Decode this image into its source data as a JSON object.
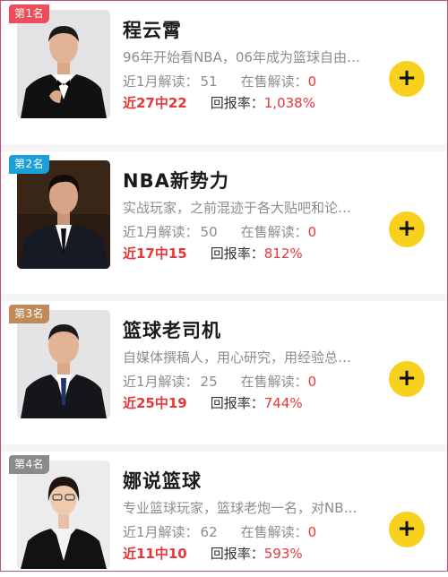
{
  "colors": {
    "rank1": "#ee4d5a",
    "rank2": "#1aa0d8",
    "rank3": "#c0895a",
    "rank4": "#8a8a8a",
    "accent_red": "#e8373a",
    "follow_yellow": "#f7d11e"
  },
  "experts": [
    {
      "rank": "第1名",
      "name": "程云霄",
      "bio": "96年开始看NBA，06年成为篮球自由…",
      "recent_label": "近1月解读：",
      "recent_count": "51",
      "on_sale_label": "在售解读：",
      "on_sale_count": "0",
      "streak": "近27中22",
      "return_label": "回报率：",
      "return_rate": "1,038%",
      "follow_icon": "+"
    },
    {
      "rank": "第2名",
      "name": "NBA新势力",
      "bio": "实战玩家，之前混迹于各大贴吧和论…",
      "recent_label": "近1月解读：",
      "recent_count": "50",
      "on_sale_label": "在售解读：",
      "on_sale_count": "0",
      "streak": "近17中15",
      "return_label": "回报率：",
      "return_rate": "812%",
      "follow_icon": "+"
    },
    {
      "rank": "第3名",
      "name": "篮球老司机",
      "bio": "自媒体撰稿人，用心研究，用经验总…",
      "recent_label": "近1月解读：",
      "recent_count": "25",
      "on_sale_label": "在售解读：",
      "on_sale_count": "0",
      "streak": "近25中19",
      "return_label": "回报率：",
      "return_rate": "744%",
      "follow_icon": "+"
    },
    {
      "rank": "第4名",
      "name": "娜说篮球",
      "bio": "专业篮球玩家，篮球老炮一名，对NB…",
      "recent_label": "近1月解读：",
      "recent_count": "62",
      "on_sale_label": "在售解读：",
      "on_sale_count": "0",
      "streak": "近11中10",
      "return_label": "回报率：",
      "return_rate": "593%",
      "follow_icon": "+"
    }
  ]
}
